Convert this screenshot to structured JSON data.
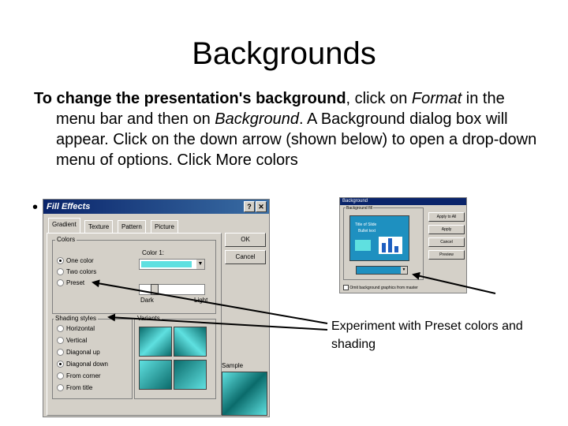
{
  "slide": {
    "title": "Backgrounds",
    "para_bold": "To change the presentation's background",
    "para_1": ", click on ",
    "para_format": "Format",
    "para_2": " in the menu bar and then on ",
    "para_background": "Background",
    "para_3": ". A Background dialog box will appear. Click on the down arrow (shown below) to open a drop-down menu of options. Click More colors",
    "bullet": "•",
    "caption": "Experiment with Preset colors and shading"
  },
  "fill_effects": {
    "title": "Fill Effects",
    "help_glyph": "?",
    "close_glyph": "✕",
    "tabs": [
      "Gradient",
      "Texture",
      "Pattern",
      "Picture"
    ],
    "colors_group": "Colors",
    "color_options": [
      "One color",
      "Two colors",
      "Preset"
    ],
    "selected_color_option": 0,
    "color1_label": "Color 1:",
    "dark_label": "Dark",
    "light_label": "Light",
    "shading_group": "Shading styles",
    "shading_options": [
      "Horizontal",
      "Vertical",
      "Diagonal up",
      "Diagonal down",
      "From corner",
      "From title"
    ],
    "selected_shading_option": 3,
    "variants_label": "Variants",
    "sample_label": "Sample",
    "ok_label": "OK",
    "cancel_label": "Cancel",
    "swatch_color": "#5fe0e0"
  },
  "background_dialog": {
    "title": "Background",
    "fill_label": "Background fill",
    "apply_all_label": "Apply to All",
    "apply_label": "Apply",
    "cancel_label": "Cancel",
    "preview_label": "Preview",
    "omit_label": "Omit background graphics from master",
    "title_text": "Title of Slide",
    "bullet_text": "Bullet text"
  },
  "colors": {
    "title_bar": "#0a246a",
    "dialog_face": "#d4d0c8",
    "teal": "#5fe0e0"
  }
}
